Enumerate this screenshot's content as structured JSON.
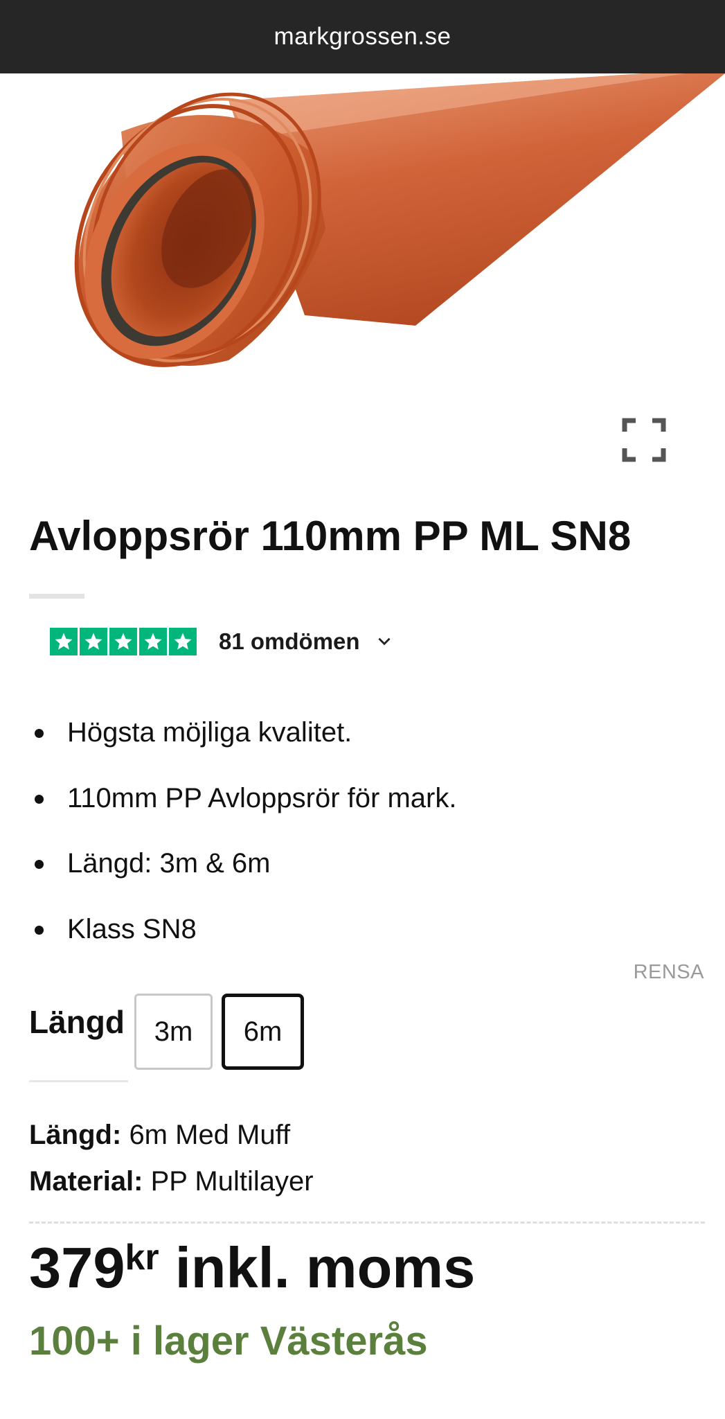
{
  "browser": {
    "domain": "markgrossen.se"
  },
  "product": {
    "title": "Avloppsrör 110mm PP ML SN8",
    "image_alt": "Orange PP sewer pipe with socket",
    "reviews": {
      "count_label": "81 omdömen",
      "stars": 5,
      "star_color": "#00b67a"
    },
    "bullets": [
      "Högsta möjliga kvalitet.",
      "110mm PP Avloppsrör för mark.",
      "Längd: 3m & 6m",
      "Klass SN8"
    ],
    "variants": {
      "clear_label": "RENSA",
      "label": "Längd",
      "options": [
        "3m",
        "6m"
      ],
      "selected": "6m"
    },
    "specs": [
      {
        "key": "Längd:",
        "value": "6m Med Muff"
      },
      {
        "key": "Material:",
        "value": "PP Multilayer"
      }
    ],
    "price": {
      "amount": "379",
      "currency": "kr",
      "suffix": "inkl. moms"
    },
    "stock": {
      "text": "100+ i lager Västerås",
      "color": "#5b7f3d"
    }
  }
}
